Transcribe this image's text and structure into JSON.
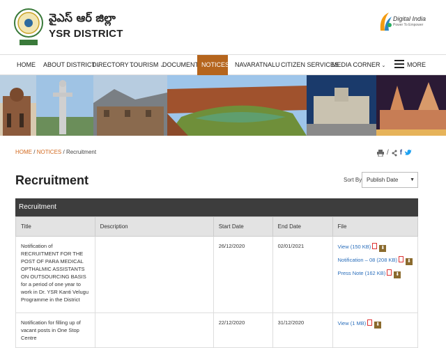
{
  "header": {
    "title_telugu": "వైఎస్ ఆర్ జిల్లా",
    "title": "YSR DISTRICT",
    "digital_india": "Digital India",
    "digital_india_sub": "Power To Empower"
  },
  "nav": {
    "items": [
      {
        "label": "HOME"
      },
      {
        "label": "ABOUT DISTRICT"
      },
      {
        "label": "DIRECTORY"
      },
      {
        "label": "TOURISM"
      },
      {
        "label": "DOCUMENTS"
      },
      {
        "label": "NOTICES"
      },
      {
        "label": "NAVARATNALU"
      },
      {
        "label": "CITIZEN SERVICES"
      },
      {
        "label": "MEDIA CORNER"
      },
      {
        "label": "MORE"
      }
    ],
    "active_color": "#b5651d"
  },
  "breadcrumb": {
    "home": "HOME",
    "notices": "NOTICES",
    "current": "Recruitment"
  },
  "page": {
    "title": "Recruitment",
    "sort_label": "Sort By:",
    "sort_value": "Publish Date"
  },
  "table": {
    "caption": "Recruitment",
    "headers": {
      "title": "Title",
      "description": "Description",
      "start": "Start Date",
      "end": "End Date",
      "file": "File"
    },
    "rows": [
      {
        "title": "Notification of RECRUITMENT FOR THE POST OF PARA MEDICAL OPTHALMIC ASSISTANTS ON OUTSOURCING BASIS for a period of one year to work in Dr. YSR Kanti Velugu Programme in the District",
        "description": "",
        "start": "26/12/2020",
        "end": "02/01/2021",
        "files": [
          "View (150 KB)",
          "Notification – 08 (208 KB)",
          "Press Note (162 KB)"
        ]
      },
      {
        "title": "Notification for filling up of vacant posts in One Stop Centre",
        "description": "",
        "start": "22/12/2020",
        "end": "31/12/2020",
        "files": [
          "View (1 MB)"
        ]
      }
    ]
  },
  "colors": {
    "table_header_bar": "#3d3d3d",
    "link": "#2a6ebb",
    "breadcrumb_link": "#d2691e"
  }
}
